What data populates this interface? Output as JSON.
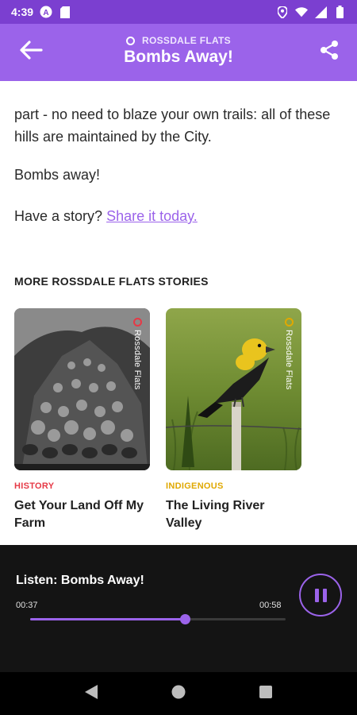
{
  "status_bar": {
    "time": "4:39",
    "icons": [
      "a-circle-icon",
      "sd-card-icon",
      "location-icon",
      "wifi-icon",
      "signal-icon",
      "battery-icon"
    ]
  },
  "app_bar": {
    "location": "ROSSDALE FLATS",
    "title": "Bombs Away!",
    "icons": [
      "back-arrow-icon",
      "share-icon"
    ]
  },
  "content": {
    "paragraph_1": "part - no need to blaze your own trails: all of these hills are maintained by the City.",
    "paragraph_2": "Bombs away!",
    "paragraph_3_prefix": "Have a story? ",
    "paragraph_3_link": "Share it today.",
    "section_heading": "MORE ROSSDALE FLATS STORIES"
  },
  "cards": [
    {
      "tag": "Rossdale Flats",
      "category": "HISTORY",
      "category_color": "#e63946",
      "title": "Get Your Land Off My Farm",
      "image": "black-and-white-vegetable-harvest-photo"
    },
    {
      "tag": "Rossdale Flats",
      "category": "INDIGENOUS",
      "category_color": "#e0a800",
      "title": "The Living River Valley",
      "image": "yellow-headed-blackbird-on-fence-post-photo"
    }
  ],
  "player": {
    "title": "Listen: Bombs Away!",
    "current_time": "00:37",
    "total_time": "00:58",
    "progress": 0.605,
    "accent": "#9b63ea"
  },
  "nav_bar": {
    "icons": [
      "back-triangle-icon",
      "home-circle-icon",
      "recents-square-icon"
    ]
  },
  "colors": {
    "status_bar": "#7b3fd0",
    "app_bar": "#9b63ea",
    "player_bg": "#141414"
  }
}
